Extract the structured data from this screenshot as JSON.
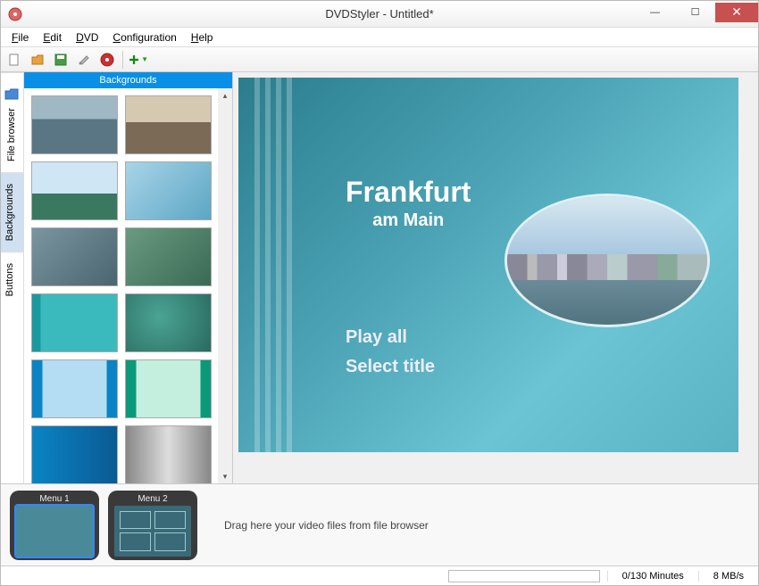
{
  "window": {
    "title": "DVDStyler - Untitled*"
  },
  "menu": {
    "file": "File",
    "edit": "Edit",
    "dvd": "DVD",
    "config": "Configuration",
    "help": "Help"
  },
  "sidetabs": {
    "file_browser": "File browser",
    "backgrounds": "Backgrounds",
    "buttons": "Buttons"
  },
  "panel": {
    "header": "Backgrounds"
  },
  "dvd": {
    "title": "Frankfurt",
    "subtitle": "am Main",
    "play_all": "Play all",
    "select_title": "Select title"
  },
  "timeline": {
    "menu1": "Menu 1",
    "menu2": "Menu 2",
    "hint": "Drag here your video files from file browser"
  },
  "status": {
    "minutes": "0/130 Minutes",
    "bitrate": "8 MB/s"
  }
}
